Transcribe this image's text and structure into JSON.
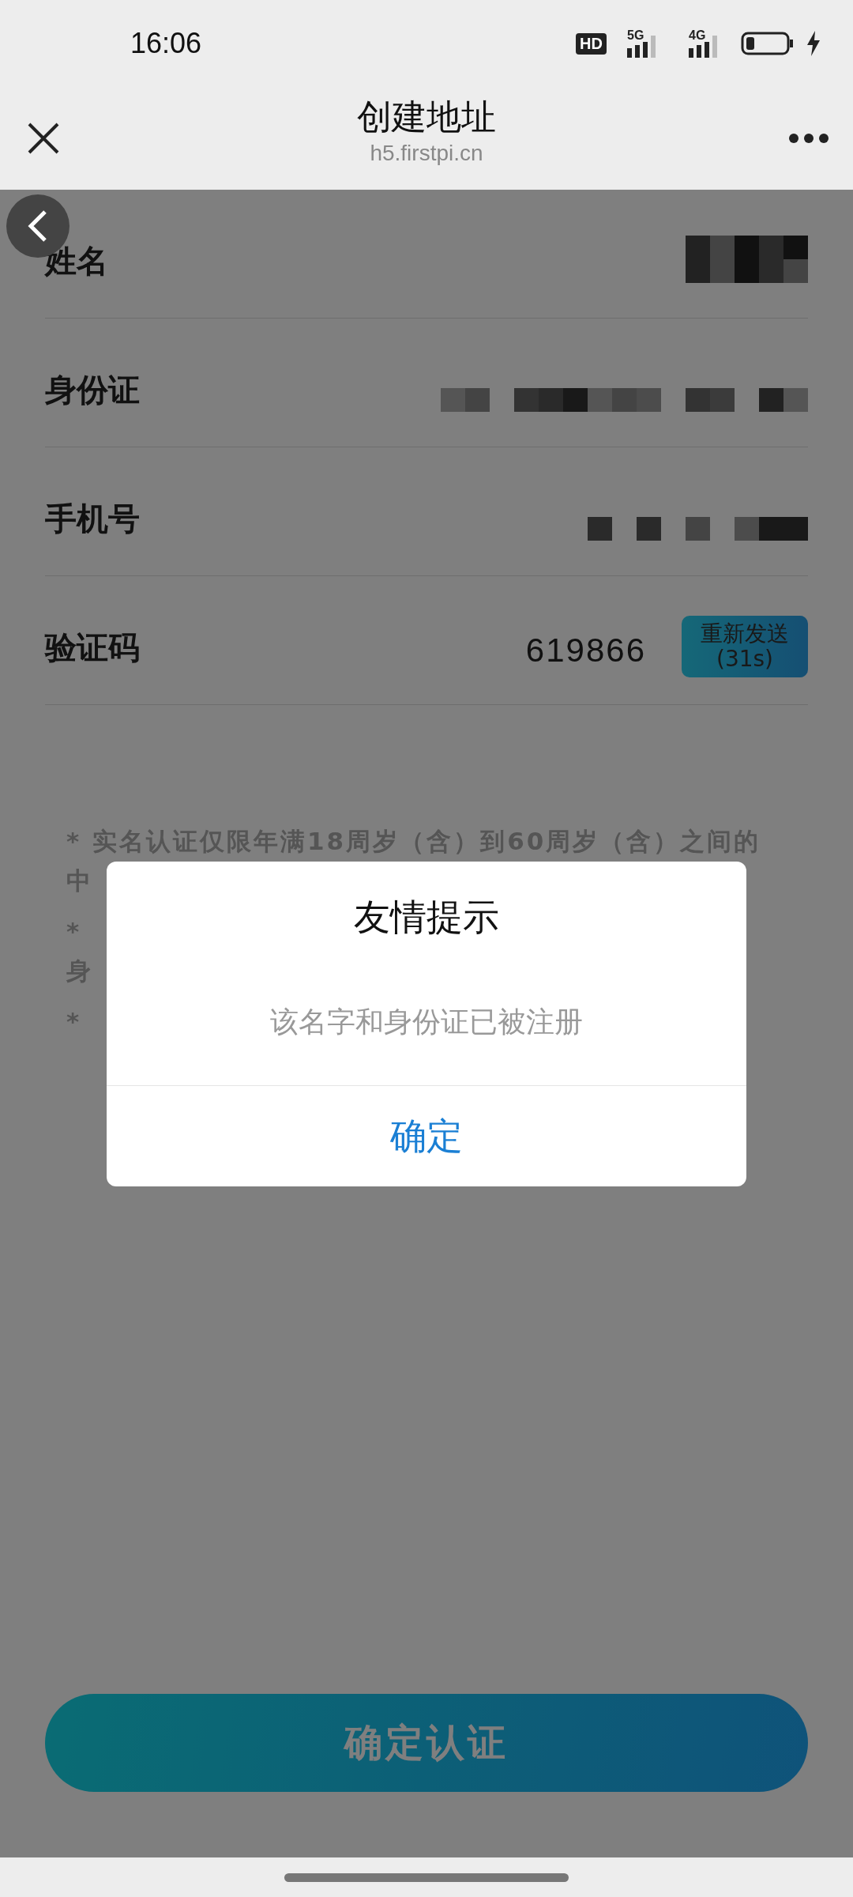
{
  "status_bar": {
    "time": "16:06",
    "hd_badge": "HD",
    "signals": [
      {
        "label": "5G"
      },
      {
        "label": "4G"
      }
    ]
  },
  "nav": {
    "title": "创建地址",
    "url": "h5.firstpi.cn"
  },
  "fields": [
    {
      "label": "姓名",
      "kind": "masked"
    },
    {
      "label": "身份证",
      "kind": "masked"
    },
    {
      "label": "手机号",
      "kind": "masked"
    },
    {
      "label": "验证码",
      "kind": "code",
      "value": "619866",
      "resend_button": "重新发送",
      "countdown": "(31s)"
    }
  ],
  "notes": [
    "* 实名认证仅限年满18周岁（含）到60周岁（含）之间的",
    "中",
    "*",
    "身",
    "*"
  ],
  "dialog": {
    "title": "友情提示",
    "message": "该名字和身份证已被注册",
    "button": "确定"
  },
  "submit_button": "确定认证"
}
